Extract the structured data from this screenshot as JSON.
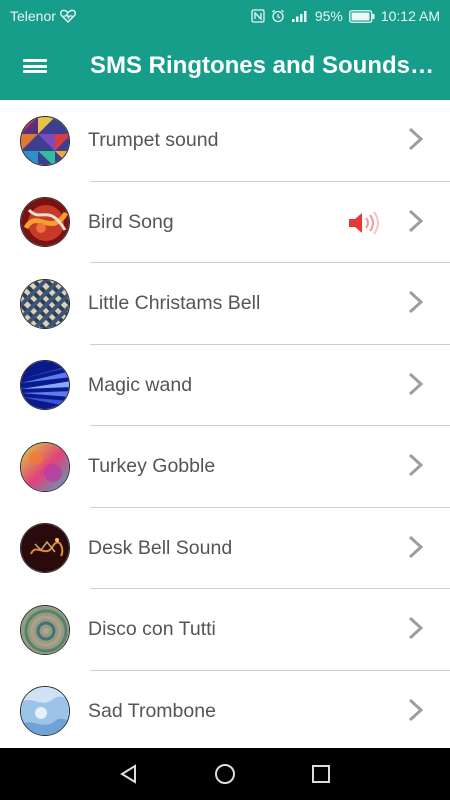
{
  "status": {
    "carrier": "Telenor",
    "battery": "95%",
    "time": "10:12 AM"
  },
  "app_bar": {
    "title": "SMS Ringtones and Sounds f..."
  },
  "ringtones": [
    {
      "name": "Trumpet sound",
      "playing": false
    },
    {
      "name": "Bird Song",
      "playing": true
    },
    {
      "name": "Little Christams Bell",
      "playing": false
    },
    {
      "name": "Magic wand",
      "playing": false
    },
    {
      "name": "Turkey Gobble",
      "playing": false
    },
    {
      "name": "Desk Bell Sound",
      "playing": false
    },
    {
      "name": "Disco con Tutti",
      "playing": false
    },
    {
      "name": "Sad Trombone",
      "playing": false
    }
  ],
  "colors": {
    "primary": "#179e8a",
    "text": "#555555",
    "chevron": "#9e9e9e",
    "speaker": "#e53935"
  }
}
